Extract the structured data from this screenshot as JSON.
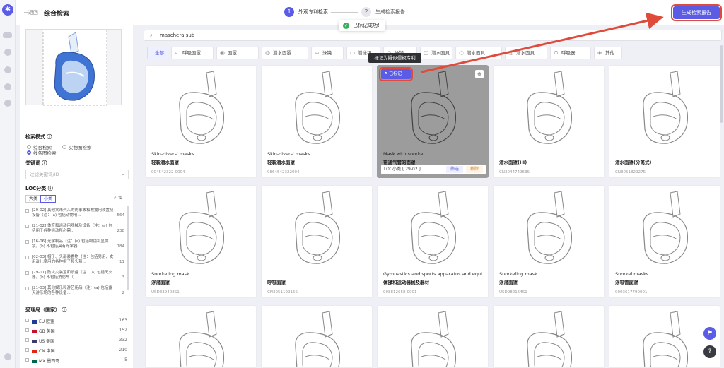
{
  "header": {
    "back_label": "←返回",
    "title": "综合检索",
    "steps": [
      {
        "num": "1",
        "label": "外观专利检索"
      },
      {
        "num": "2",
        "label": "生成检索报告"
      }
    ],
    "generate_button": "生成检索报告",
    "toast": "已标记成功!"
  },
  "left": {
    "search_mode_label": "检索模式",
    "modes": [
      "综合检索",
      "实物图检索",
      "线条图检索"
    ],
    "selected_mode": "线条图检索",
    "keyword_label": "关键词",
    "keyword_placeholder": "过滤关键词/ID",
    "loc_label": "LOC分类",
    "loc_tabs": [
      "大类",
      "小类"
    ],
    "loc_items": [
      {
        "text": "[29-02] 其他案未列入的防事故和救援用装置及设备（注：(a) 包括动物用...",
        "count": "564"
      },
      {
        "text": "[21-02] 体育和运动用器械及设备（注：(a) 包括用于各种运动所必需...",
        "count": "238"
      },
      {
        "text": "[16-06] 光学制品（注：(a) 包括眼镜和显微镜。(b) 不包括具有光学器...",
        "count": "184"
      },
      {
        "text": "[02-03] 帽子、头部装置物（注：包括男用、女用及儿童用的各种帽子和头盔...",
        "count": "11"
      },
      {
        "text": "[29-01] 防火灾装置和设备（注：(a) 包括灭火器。(b) 不包括消防车（...",
        "count": "3"
      },
      {
        "text": "[21-03] 其他娱乐和游艺用品（注：(a) 包括露天游乐场的各种设备...",
        "count": "2"
      }
    ],
    "country_label": "受理局（国家）",
    "countries": [
      {
        "label": "EU 欧盟",
        "count": "163",
        "flag": "#1f3b99"
      },
      {
        "label": "GB 英国",
        "count": "152",
        "flag": "#c8102e"
      },
      {
        "label": "US 美国",
        "count": "332",
        "flag": "#3c3b6e"
      },
      {
        "label": "CN 中国",
        "count": "210",
        "flag": "#de2910"
      },
      {
        "label": "MX 墨西哥",
        "count": "5",
        "flag": "#006847"
      }
    ]
  },
  "main": {
    "search_value": "maschera sub",
    "categories": [
      {
        "label": "全部",
        "icon": "",
        "active": true
      },
      {
        "label": "呼吸面罩",
        "icon": "⌕"
      },
      {
        "label": "面罩",
        "icon": "◉"
      },
      {
        "label": "潜水面罩",
        "icon": "◍"
      },
      {
        "label": "泳镜",
        "icon": "∞"
      },
      {
        "label": "潜泳镜",
        "icon": "▭"
      },
      {
        "label": "泳镜",
        "icon": "◇"
      },
      {
        "label": "潜水面具",
        "icon": "▢"
      },
      {
        "label": "潜水面具",
        "icon": "◌"
      },
      {
        "label": "潜水面具",
        "icon": "◎"
      },
      {
        "label": "呼吸器",
        "icon": "⊙"
      },
      {
        "label": "其他",
        "icon": "◈"
      }
    ],
    "tooltip": "标记为疑似侵权专利",
    "mark_label": "已标记",
    "loc_bar": "LOC小类 [ 29-02 ]",
    "filter_label": "筛选",
    "remove_label": "移除",
    "cards": [
      {
        "en": "Skin-divers' masks",
        "cn": "轻装潜水面罩",
        "no": "004542322-0004"
      },
      {
        "en": "Skin-divers' masks",
        "cn": "轻装潜水面罩",
        "no": "9864542322004"
      },
      {
        "en": "Mask with snorkel",
        "cn": "带通气管的面罩",
        "no": "",
        "highlight": true
      },
      {
        "en": "",
        "cn": "潜水面罩(III)",
        "no": "CN304474963S"
      },
      {
        "en": "",
        "cn": "潜水面罩(分离式)",
        "no": "CN305182927S"
      },
      {
        "en": "Snorkeling mask",
        "cn": "浮潜面罩",
        "no": "USD839408S1"
      },
      {
        "en": "",
        "cn": "呼吸面罩",
        "no": "CN305119915S"
      },
      {
        "en": "Gymnastics and sports apparatus and equi...",
        "cn": "体操和运动器械及器材",
        "no": "008812658-0001"
      },
      {
        "en": "Snorkeling mask",
        "cn": "浮潜面罩",
        "no": "USD982154S1"
      },
      {
        "en": "Snorkel masks",
        "cn": "浮吸管面罩",
        "no": "9003617790001"
      },
      {
        "en": "",
        "cn": "",
        "no": ""
      },
      {
        "en": "",
        "cn": "",
        "no": ""
      },
      {
        "en": "",
        "cn": "",
        "no": ""
      },
      {
        "en": "",
        "cn": "",
        "no": ""
      },
      {
        "en": "",
        "cn": "",
        "no": ""
      }
    ]
  },
  "colors": {
    "accent": "#5b5ce6",
    "highlight_outline": "#e04a3a",
    "success": "#3aae5a"
  }
}
